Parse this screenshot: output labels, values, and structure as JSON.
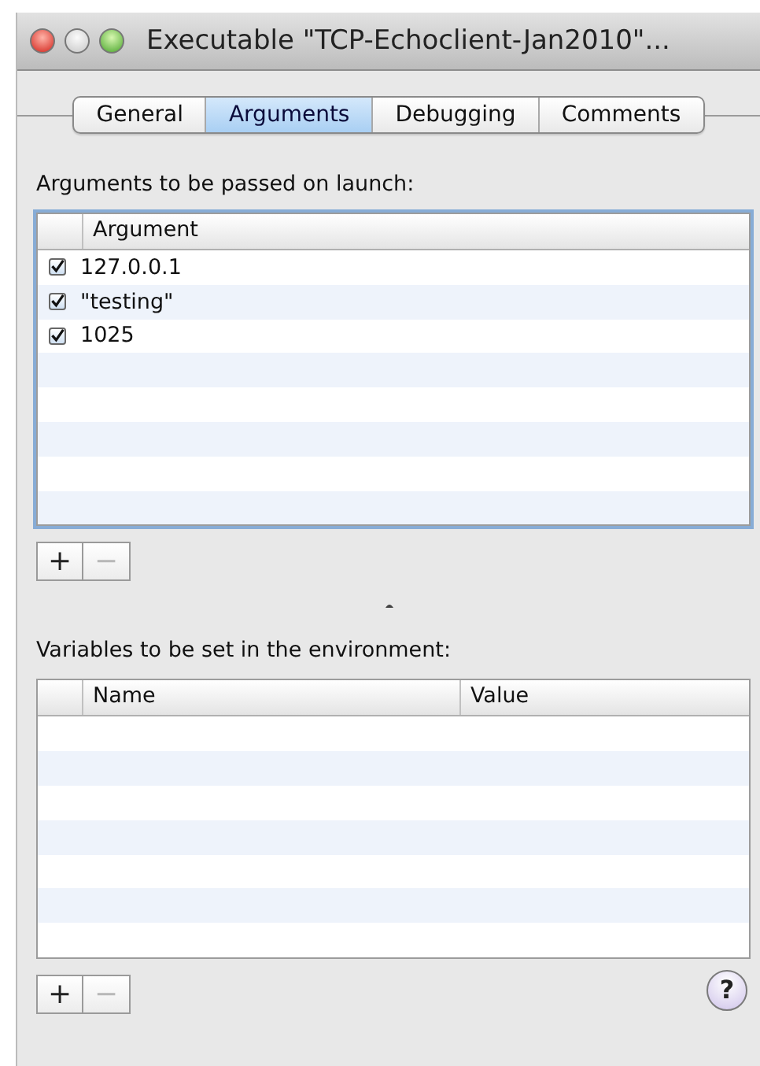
{
  "window": {
    "title": "Executable \"TCP-Echoclient-Jan2010\"..."
  },
  "tabs": [
    {
      "label": "General",
      "selected": false
    },
    {
      "label": "Arguments",
      "selected": true
    },
    {
      "label": "Debugging",
      "selected": false
    },
    {
      "label": "Comments",
      "selected": false
    }
  ],
  "arguments": {
    "label": "Arguments to be passed on launch:",
    "columns": [
      "Argument"
    ],
    "rows": [
      {
        "checked": true,
        "value": "127.0.0.1"
      },
      {
        "checked": true,
        "value": "\"testing\""
      },
      {
        "checked": true,
        "value": "1025"
      }
    ],
    "buttons": [
      {
        "label": "+",
        "disabled": false
      },
      {
        "label": "−",
        "disabled": true
      }
    ]
  },
  "environment": {
    "label": "Variables to be set in the environment:",
    "columns": [
      "Name",
      "Value"
    ],
    "buttons": [
      {
        "label": "+",
        "disabled": false
      },
      {
        "label": "−",
        "disabled": true
      }
    ]
  },
  "help_button": {
    "label": "?"
  }
}
